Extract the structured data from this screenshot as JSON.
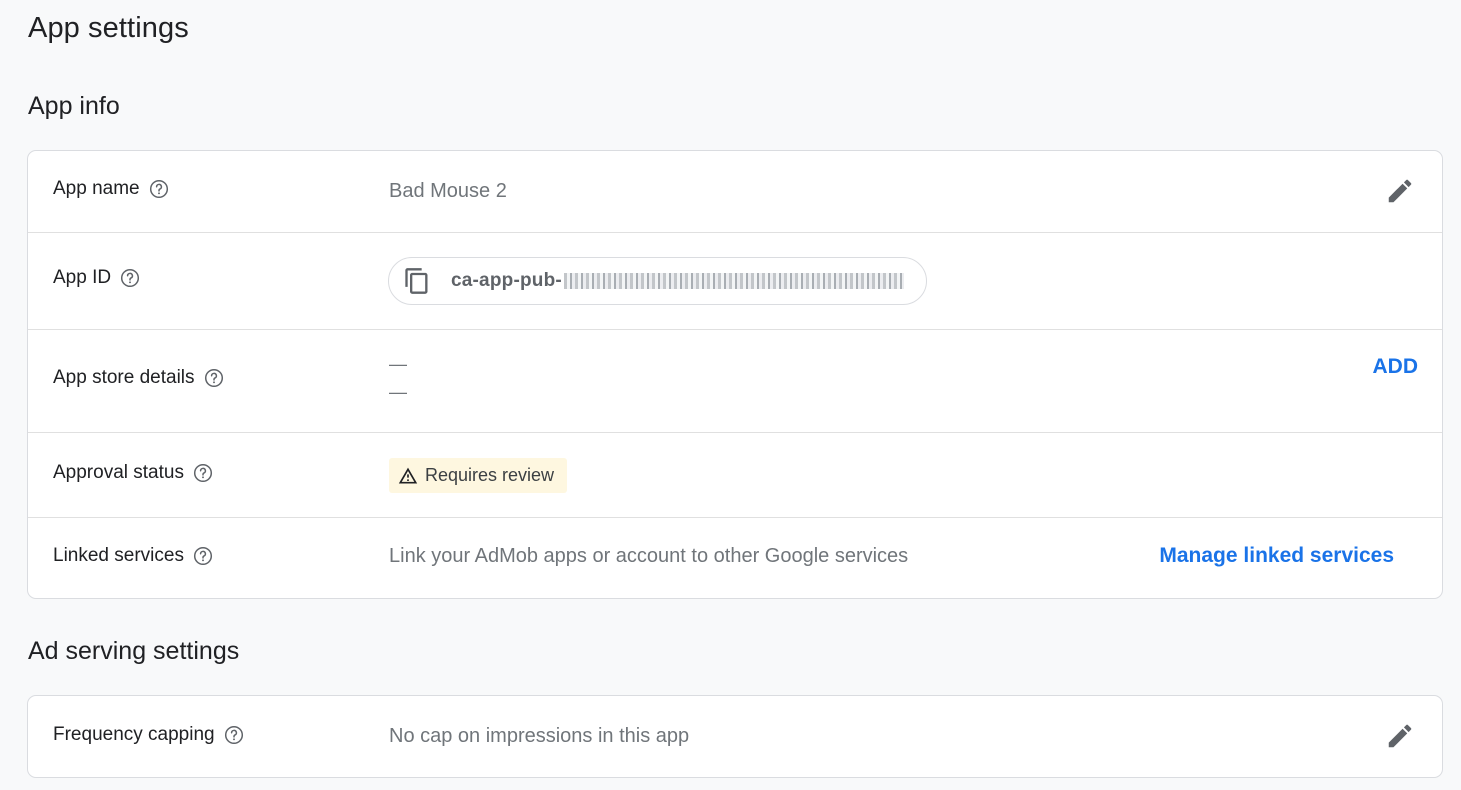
{
  "page": {
    "title": "App settings"
  },
  "app_info": {
    "section_title": "App info",
    "app_name": {
      "label": "App name",
      "value": "Bad Mouse 2",
      "icon": "edit-icon"
    },
    "app_id": {
      "label": "App ID",
      "prefix": "ca-app-pub-",
      "icon": "copy-icon"
    },
    "app_store": {
      "label": "App store details",
      "line1": "—",
      "line2": "—",
      "action": "ADD"
    },
    "approval": {
      "label": "Approval status",
      "status": "Requires review",
      "icon": "warning-icon"
    },
    "linked": {
      "label": "Linked services",
      "description": "Link your AdMob apps or account to other Google services",
      "action": "Manage linked services"
    }
  },
  "ad_serving": {
    "section_title": "Ad serving settings",
    "frequency": {
      "label": "Frequency capping",
      "value": "No cap on impressions in this app",
      "icon": "edit-icon"
    }
  },
  "colors": {
    "accent": "#1a73e8",
    "status_bg": "#fef7e0",
    "page_bg": "#f8f9fa"
  }
}
